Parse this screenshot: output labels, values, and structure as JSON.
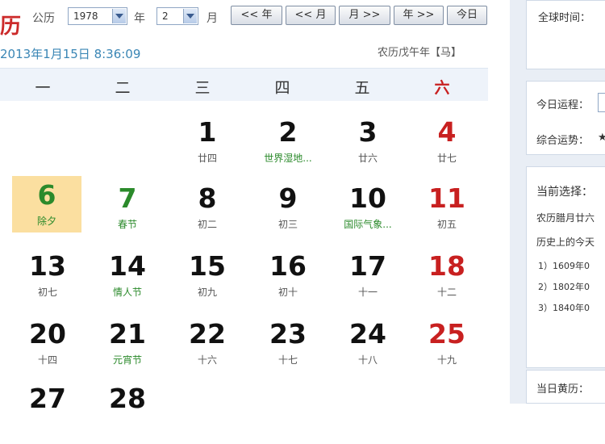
{
  "header": {
    "brand_char": "历",
    "calendar_label": "公历",
    "year_value": "1978",
    "year_label": "年",
    "month_value": "2",
    "month_label": "月",
    "nav_buttons": {
      "prev_year": "<< 年",
      "prev_month": "<< 月",
      "next_month": "月 >>",
      "next_year": "年 >>",
      "today": "今日"
    },
    "current_time": "2013年1月15日 8:36:09",
    "lunar_year": "农历戊午年【马】"
  },
  "weekdays": [
    "一",
    "二",
    "三",
    "四",
    "五",
    "六"
  ],
  "days": [
    {
      "day": "1",
      "sub": "廿四"
    },
    {
      "day": "2",
      "sub": "世界湿地..."
    },
    {
      "day": "3",
      "sub": "廿六"
    },
    {
      "day": "4",
      "sub": "廿七"
    },
    {
      "day": "6",
      "sub": "除夕"
    },
    {
      "day": "7",
      "sub": "春节"
    },
    {
      "day": "8",
      "sub": "初二"
    },
    {
      "day": "9",
      "sub": "初三"
    },
    {
      "day": "10",
      "sub": "国际气象..."
    },
    {
      "day": "11",
      "sub": "初五"
    },
    {
      "day": "13",
      "sub": "初七"
    },
    {
      "day": "14",
      "sub": "情人节"
    },
    {
      "day": "15",
      "sub": "初九"
    },
    {
      "day": "16",
      "sub": "初十"
    },
    {
      "day": "17",
      "sub": "十一"
    },
    {
      "day": "18",
      "sub": "十二"
    },
    {
      "day": "20",
      "sub": "十四"
    },
    {
      "day": "21",
      "sub": "元宵节"
    },
    {
      "day": "22",
      "sub": "十六"
    },
    {
      "day": "23",
      "sub": "十七"
    },
    {
      "day": "24",
      "sub": "十八"
    },
    {
      "day": "25",
      "sub": "十九"
    },
    {
      "day": "27",
      "sub": ""
    },
    {
      "day": "28",
      "sub": ""
    }
  ],
  "side": {
    "beijing_time_label": "全球时间：",
    "today_fortune_label": "今日运程：",
    "overall_fortune_label": "综合运势：",
    "overall_fortune_stars": "★",
    "selection_label": "当前选择：",
    "lunar_line": "农历腊月廿六",
    "history_label": "历史上的今天",
    "history_items": [
      "1）1609年0",
      "2）1802年0",
      "3）1840年0"
    ],
    "almanac_label": "当日黄历："
  }
}
